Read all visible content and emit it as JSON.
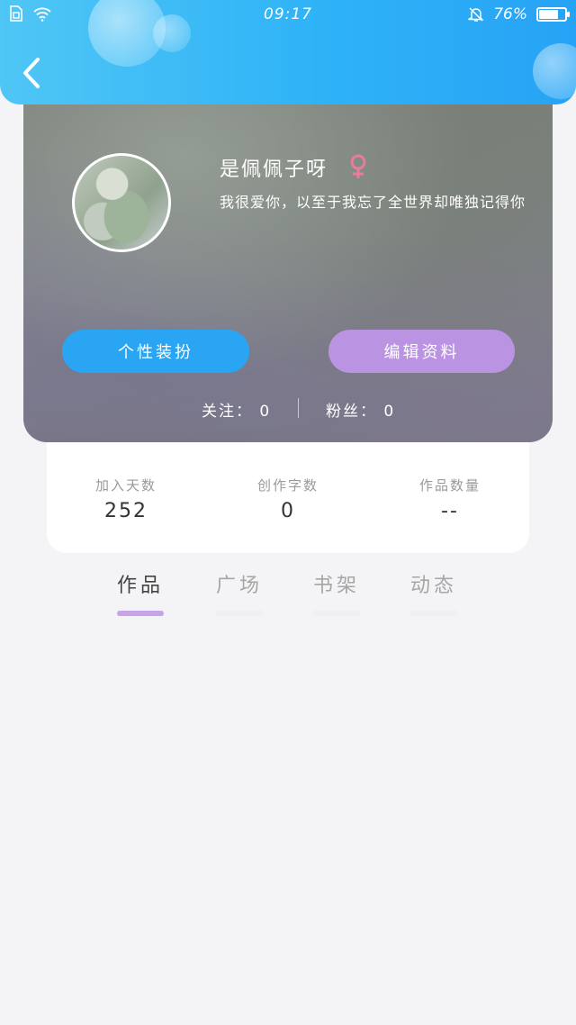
{
  "status_bar": {
    "time": "09:17",
    "battery": "76%",
    "battery_level": 0.76
  },
  "header": {
    "back_icon": "chevron-left-icon"
  },
  "profile": {
    "nickname": "是佩佩子呀",
    "gender_icon": "female-icon",
    "bio": "我很爱你，以至于我忘了全世界却唯独记得你",
    "dress_button": "个性装扮",
    "edit_button": "编辑资料",
    "following": "关注： 0",
    "fans": "粉丝： 0"
  },
  "stats": [
    {
      "label": "加入天数",
      "value": "252"
    },
    {
      "label": "创作字数",
      "value": "0"
    },
    {
      "label": "作品数量",
      "value": "--"
    }
  ],
  "tabs": [
    {
      "label": "作品",
      "active": true
    },
    {
      "label": "广场",
      "active": false
    },
    {
      "label": "书架",
      "active": false
    },
    {
      "label": "动态",
      "active": false
    }
  ],
  "colors": {
    "header_gradient_start": "#4fc6f5",
    "header_gradient_end": "#27a3f5",
    "dress_button": "#2aa5f4",
    "edit_button": "#bb93e3",
    "active_tab_indicator": "#c6a4e8",
    "gender_icon": "#e97aa0",
    "page_background": "#f4f4f6"
  }
}
